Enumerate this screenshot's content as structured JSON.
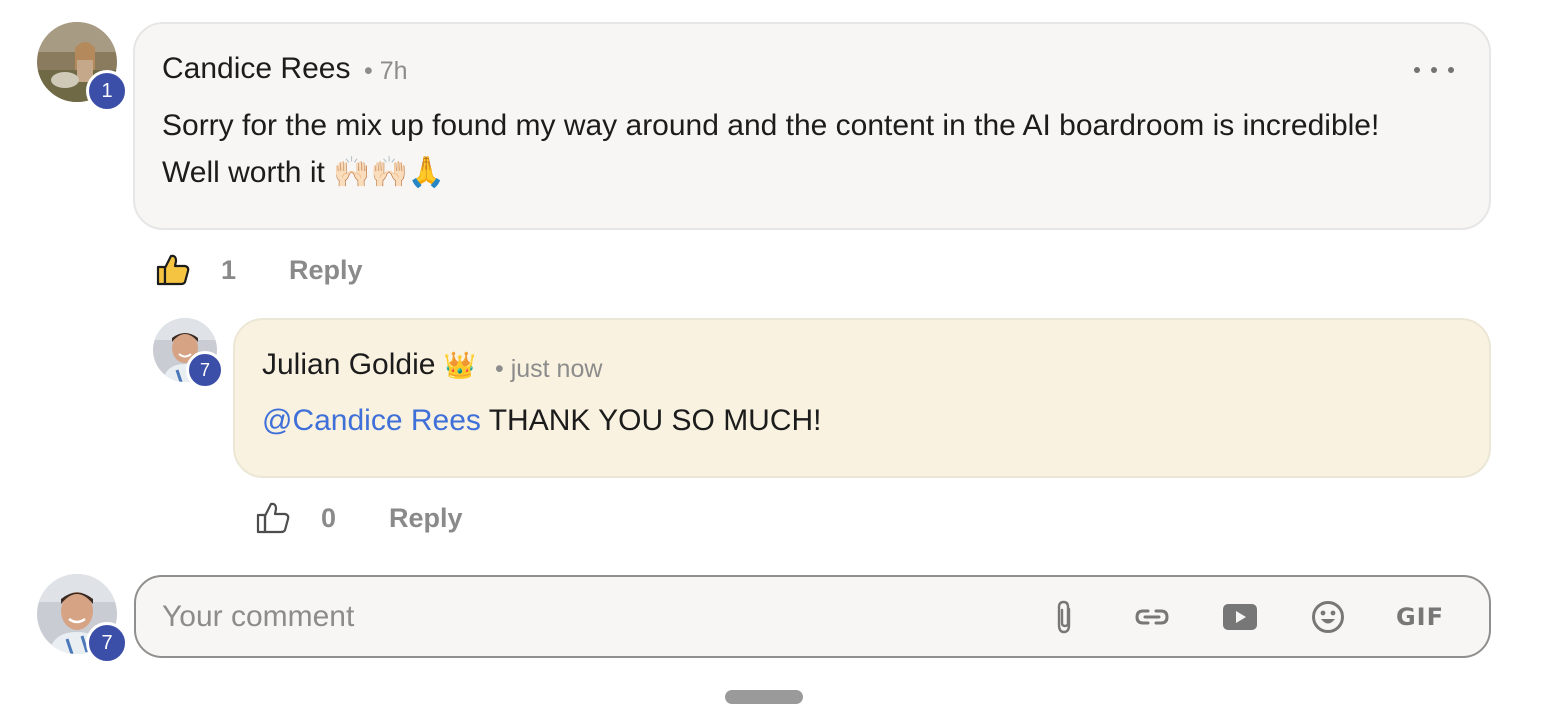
{
  "comments": [
    {
      "author": "Candice Rees",
      "time": "• 7h",
      "level": "1",
      "lines": [
        "Sorry for the mix up found my way around and the content in the AI boardroom is incredible!",
        "Well worth it 🙌🏻🙌🏻🙏"
      ],
      "like_count": "1",
      "reply_label": "Reply",
      "liked": true
    }
  ],
  "replies": [
    {
      "author": "Julian Goldie",
      "badge": "👑",
      "time": "• just now",
      "level": "7",
      "mention": "@Candice Rees",
      "text": " THANK YOU SO MUCH!",
      "like_count": "0",
      "reply_label": "Reply",
      "liked": false
    }
  ],
  "composer": {
    "placeholder": "Your comment",
    "level": "7",
    "tools": [
      "paperclip-icon",
      "link-icon",
      "video-icon",
      "emoji-icon",
      "gif-icon"
    ],
    "gif_label": "GIF"
  },
  "colors": {
    "accent_badge": "#3b4fa8",
    "mention": "#3f6fd8",
    "reply_bubble": "#f9f2e0",
    "comment_bubble": "#f7f6f4",
    "liked_thumb": "#f5c542"
  }
}
